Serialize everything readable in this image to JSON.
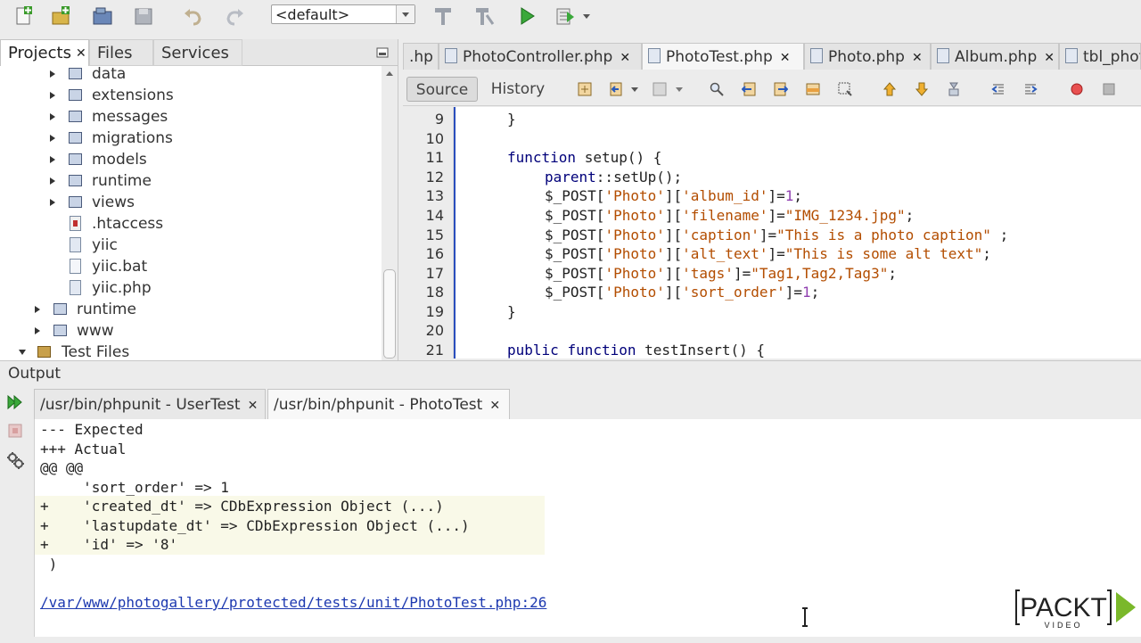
{
  "toolbar": {
    "config_combo_value": "<default>"
  },
  "projects": {
    "tabs": [
      {
        "label": "Projects",
        "close": "✕"
      },
      {
        "label": "Files"
      },
      {
        "label": "Services"
      }
    ],
    "tree": [
      {
        "label": "data",
        "type": "folder"
      },
      {
        "label": "extensions",
        "type": "folder"
      },
      {
        "label": "messages",
        "type": "folder"
      },
      {
        "label": "migrations",
        "type": "folder"
      },
      {
        "label": "models",
        "type": "folder"
      },
      {
        "label": "runtime",
        "type": "folder"
      },
      {
        "label": "views",
        "type": "folder"
      },
      {
        "label": ".htaccess",
        "type": "file"
      },
      {
        "label": "yiic",
        "type": "file"
      },
      {
        "label": "yiic.bat",
        "type": "file"
      },
      {
        "label": "yiic.php",
        "type": "file"
      },
      {
        "label": "runtime",
        "type": "folder"
      },
      {
        "label": "www",
        "type": "folder"
      },
      {
        "label": "Test Files",
        "type": "folder"
      }
    ]
  },
  "editor": {
    "tabs": [
      {
        "label": ".hp"
      },
      {
        "label": "PhotoController.php",
        "close": "✕"
      },
      {
        "label": "PhotoTest.php",
        "close": "✕"
      },
      {
        "label": "Photo.php",
        "close": "✕"
      },
      {
        "label": "Album.php",
        "close": "✕"
      },
      {
        "label": "tbl_phot"
      }
    ],
    "source_label": "Source",
    "history_label": "History",
    "line_numbers": [
      "9",
      "10",
      "11",
      "12",
      "13",
      "14",
      "15",
      "16",
      "17",
      "18",
      "19",
      "20",
      "21"
    ]
  },
  "code": {
    "line9": "}",
    "line11_kw": "function",
    "line11_rest": " setup() {",
    "line12_kw": "parent",
    "line12_rest": "::setUp();",
    "line13_a": "$_POST[",
    "line13_s1": "'Photo'",
    "line13_b": "][",
    "line13_s2": "'album_id'",
    "line13_c": "]=",
    "line13_n": "1",
    "line13_d": ";",
    "line14_a": "$_POST[",
    "line14_s1": "'Photo'",
    "line14_b": "][",
    "line14_s2": "'filename'",
    "line14_c": "]=",
    "line14_s3": "\"IMG_1234.jpg\"",
    "line14_d": ";",
    "line15_a": "$_POST[",
    "line15_s1": "'Photo'",
    "line15_b": "][",
    "line15_s2": "'caption'",
    "line15_c": "]=",
    "line15_s3": "\"This is a photo caption\"",
    "line15_d": " ;",
    "line16_a": "$_POST[",
    "line16_s1": "'Photo'",
    "line16_b": "][",
    "line16_s2": "'alt_text'",
    "line16_c": "]=",
    "line16_s3": "\"This is some alt text\"",
    "line16_d": ";",
    "line17_a": "$_POST[",
    "line17_s1": "'Photo'",
    "line17_b": "][",
    "line17_s2": "'tags'",
    "line17_c": "]=",
    "line17_s3": "\"Tag1,Tag2,Tag3\"",
    "line17_d": ";",
    "line18_a": "$_POST[",
    "line18_s1": "'Photo'",
    "line18_b": "][",
    "line18_s2": "'sort_order'",
    "line18_c": "]=",
    "line18_n": "1",
    "line18_d": ";",
    "line19": "}",
    "line21_kw1": "public",
    "line21_kw2": "function",
    "line21_rest": " testInsert() {"
  },
  "output": {
    "title": "Output",
    "tabs": [
      {
        "label": "/usr/bin/phpunit - UserTest",
        "close": "✕"
      },
      {
        "label": "/usr/bin/phpunit - PhotoTest",
        "close": "✕"
      }
    ],
    "lines": [
      "--- Expected",
      "+++ Actual",
      "@@ @@",
      "     'sort_order' => 1",
      "+    'created_dt' => CDbExpression Object (...)",
      "+    'lastupdate_dt' => CDbExpression Object (...)",
      "+    'id' => '8'",
      " )"
    ],
    "link": "/var/www/photogallery/protected/tests/unit/PhotoTest.php:26"
  },
  "logo": {
    "main": "PACKT",
    "sub": "VIDEO"
  },
  "colors": {
    "keyword": "#00007a",
    "string": "#b34d00",
    "number": "#9040b0",
    "link": "#1d39b0",
    "fold": "#2a4ebd"
  }
}
